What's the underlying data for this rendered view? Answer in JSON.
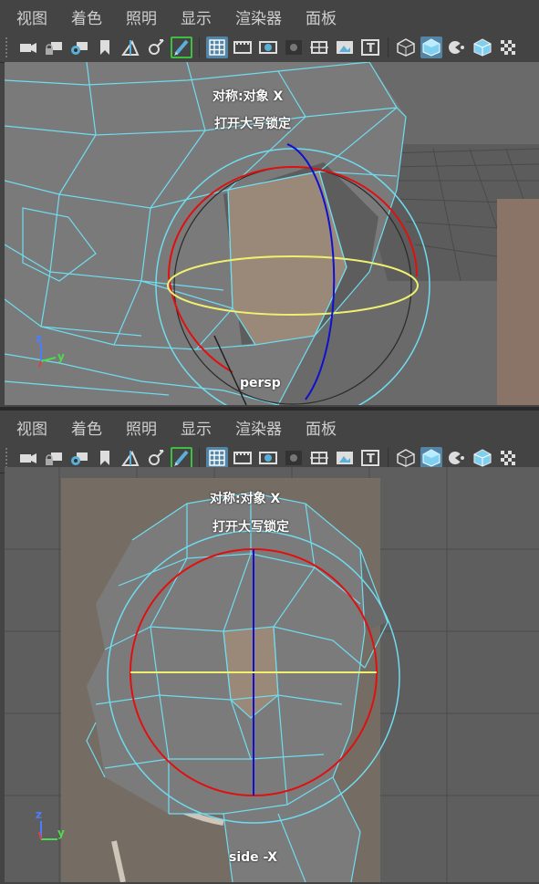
{
  "menu": [
    "视图",
    "着色",
    "照明",
    "显示",
    "渲染器",
    "面板"
  ],
  "toolbar_icons": [
    {
      "name": "camera-icon",
      "active": false
    },
    {
      "name": "camera-lock-icon",
      "active": false
    },
    {
      "name": "camera-attributes-icon",
      "active": false
    },
    {
      "name": "bookmark-icon",
      "active": false
    },
    {
      "name": "image-plane-icon",
      "active": false
    },
    {
      "name": "pan-zoom-icon",
      "active": false
    },
    {
      "name": "grease-pencil-icon",
      "active": false,
      "highlight": true
    },
    {
      "name": "grid-icon",
      "active": true
    },
    {
      "name": "film-gate-icon",
      "active": false
    },
    {
      "name": "resolution-gate-icon",
      "active": false
    },
    {
      "name": "gate-mask-icon",
      "active": false
    },
    {
      "name": "field-chart-icon",
      "active": false
    },
    {
      "name": "safe-action-icon",
      "active": false
    },
    {
      "name": "safe-title-icon",
      "active": false
    },
    {
      "name": "wireframe-icon",
      "active": false
    },
    {
      "name": "smooth-shade-icon",
      "active": true
    },
    {
      "name": "shade-options-icon",
      "active": false
    },
    {
      "name": "wireframe-on-shaded-icon",
      "active": false
    },
    {
      "name": "xray-icon",
      "active": false
    }
  ],
  "viewports": [
    {
      "id": "top",
      "hud_line1": "对称:对象 X",
      "hud_line2": "打开大写锁定",
      "camera": "persp",
      "axis_z": "z",
      "axis_y": "y"
    },
    {
      "id": "bottom",
      "hud_line1": "对称:对象 X",
      "hud_line2": "打开大写锁定",
      "camera": "side -X",
      "axis_z": "z",
      "axis_y": "y"
    }
  ],
  "colors": {
    "wire": "#6fdcf0",
    "manip_red": "#e01010",
    "manip_blue": "#1010d0",
    "manip_yellow": "#f0f070",
    "selected_face": "#9a8878",
    "active_tool": "#5285a6"
  }
}
